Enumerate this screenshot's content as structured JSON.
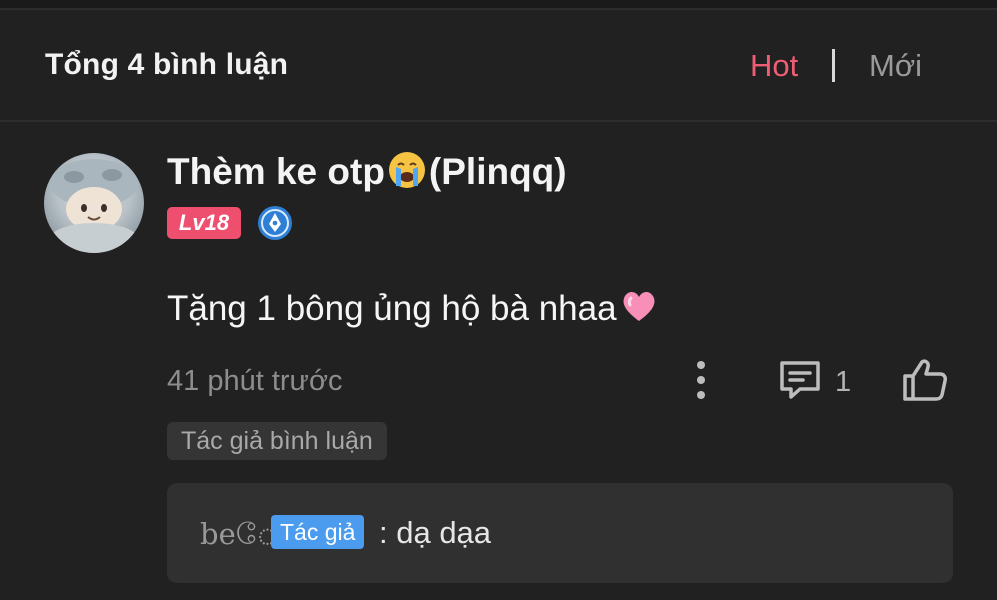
{
  "header": {
    "title": "Tổng 4 bình luận",
    "sort_hot": "Hot",
    "sort_separator": "|",
    "sort_new": "Mới"
  },
  "comment": {
    "username": "Thèm ke otp",
    "username_suffix": "(Plinqq)",
    "username_emoji": "loudly-crying-face",
    "level": "Lv18",
    "text": "Tặng 1 bông ủng hộ bà nhaa",
    "text_emoji": "pink-heart",
    "time": "41 phút trước",
    "reply_count": "1",
    "author_tag": "Tác giả bình luận"
  },
  "reply": {
    "name": "beே",
    "author_badge": "Tác giả",
    "text": ": dạ dạa"
  },
  "colors": {
    "background": "#212121",
    "hot_accent": "#ef5d74",
    "level_badge": "#ef4f6f",
    "author_badge": "#4b9cee",
    "reply_box": "#303030"
  },
  "icons": [
    "avatar-image",
    "crying-emoji-icon",
    "verified-quill-icon",
    "heart-emoji-icon",
    "more-vertical-icon",
    "reply-comment-icon",
    "thumbs-up-icon"
  ]
}
